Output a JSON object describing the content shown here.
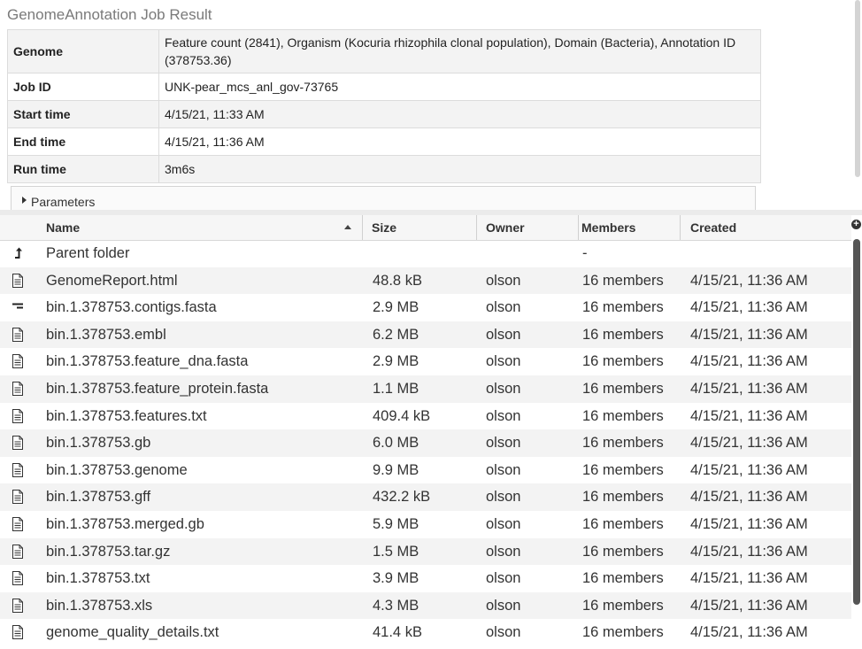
{
  "title": "GenomeAnnotation Job Result",
  "summary": {
    "genome_label": "Genome",
    "genome_value": "Feature count (2841), Organism (Kocuria rhizophila clonal population), Domain (Bacteria), Annotation ID (378753.36)",
    "jobid_label": "Job ID",
    "jobid_value": "UNK-pear_mcs_anl_gov-73765",
    "start_label": "Start time",
    "start_value": "4/15/21, 11:33 AM",
    "end_label": "End time",
    "end_value": "4/15/21, 11:36 AM",
    "run_label": "Run time",
    "run_value": "3m6s"
  },
  "parameters_label": "Parameters",
  "grid": {
    "columns": {
      "name": "Name",
      "size": "Size",
      "owner": "Owner",
      "members": "Members",
      "created": "Created"
    },
    "add_column_glyph": "+",
    "rows": [
      {
        "icon": "parent-folder-icon",
        "name": "Parent folder",
        "size": "",
        "owner": "",
        "members": "-",
        "created": ""
      },
      {
        "icon": "document-icon",
        "name": "GenomeReport.html",
        "size": "48.8 kB",
        "owner": "olson",
        "members": "16 members",
        "created": "4/15/21, 11:36 AM"
      },
      {
        "icon": "contigs-icon",
        "name": "bin.1.378753.contigs.fasta",
        "size": "2.9 MB",
        "owner": "olson",
        "members": "16 members",
        "created": "4/15/21, 11:36 AM"
      },
      {
        "icon": "document-icon",
        "name": "bin.1.378753.embl",
        "size": "6.2 MB",
        "owner": "olson",
        "members": "16 members",
        "created": "4/15/21, 11:36 AM"
      },
      {
        "icon": "document-icon",
        "name": "bin.1.378753.feature_dna.fasta",
        "size": "2.9 MB",
        "owner": "olson",
        "members": "16 members",
        "created": "4/15/21, 11:36 AM"
      },
      {
        "icon": "document-icon",
        "name": "bin.1.378753.feature_protein.fasta",
        "size": "1.1 MB",
        "owner": "olson",
        "members": "16 members",
        "created": "4/15/21, 11:36 AM"
      },
      {
        "icon": "document-icon",
        "name": "bin.1.378753.features.txt",
        "size": "409.4 kB",
        "owner": "olson",
        "members": "16 members",
        "created": "4/15/21, 11:36 AM"
      },
      {
        "icon": "document-icon",
        "name": "bin.1.378753.gb",
        "size": "6.0 MB",
        "owner": "olson",
        "members": "16 members",
        "created": "4/15/21, 11:36 AM"
      },
      {
        "icon": "document-icon",
        "name": "bin.1.378753.genome",
        "size": "9.9 MB",
        "owner": "olson",
        "members": "16 members",
        "created": "4/15/21, 11:36 AM"
      },
      {
        "icon": "document-icon",
        "name": "bin.1.378753.gff",
        "size": "432.2 kB",
        "owner": "olson",
        "members": "16 members",
        "created": "4/15/21, 11:36 AM"
      },
      {
        "icon": "document-icon",
        "name": "bin.1.378753.merged.gb",
        "size": "5.9 MB",
        "owner": "olson",
        "members": "16 members",
        "created": "4/15/21, 11:36 AM"
      },
      {
        "icon": "document-icon",
        "name": "bin.1.378753.tar.gz",
        "size": "1.5 MB",
        "owner": "olson",
        "members": "16 members",
        "created": "4/15/21, 11:36 AM"
      },
      {
        "icon": "document-icon",
        "name": "bin.1.378753.txt",
        "size": "3.9 MB",
        "owner": "olson",
        "members": "16 members",
        "created": "4/15/21, 11:36 AM"
      },
      {
        "icon": "document-icon",
        "name": "bin.1.378753.xls",
        "size": "4.3 MB",
        "owner": "olson",
        "members": "16 members",
        "created": "4/15/21, 11:36 AM"
      },
      {
        "icon": "document-icon",
        "name": "genome_quality_details.txt",
        "size": "41.4 kB",
        "owner": "olson",
        "members": "16 members",
        "created": "4/15/21, 11:36 AM"
      }
    ]
  }
}
